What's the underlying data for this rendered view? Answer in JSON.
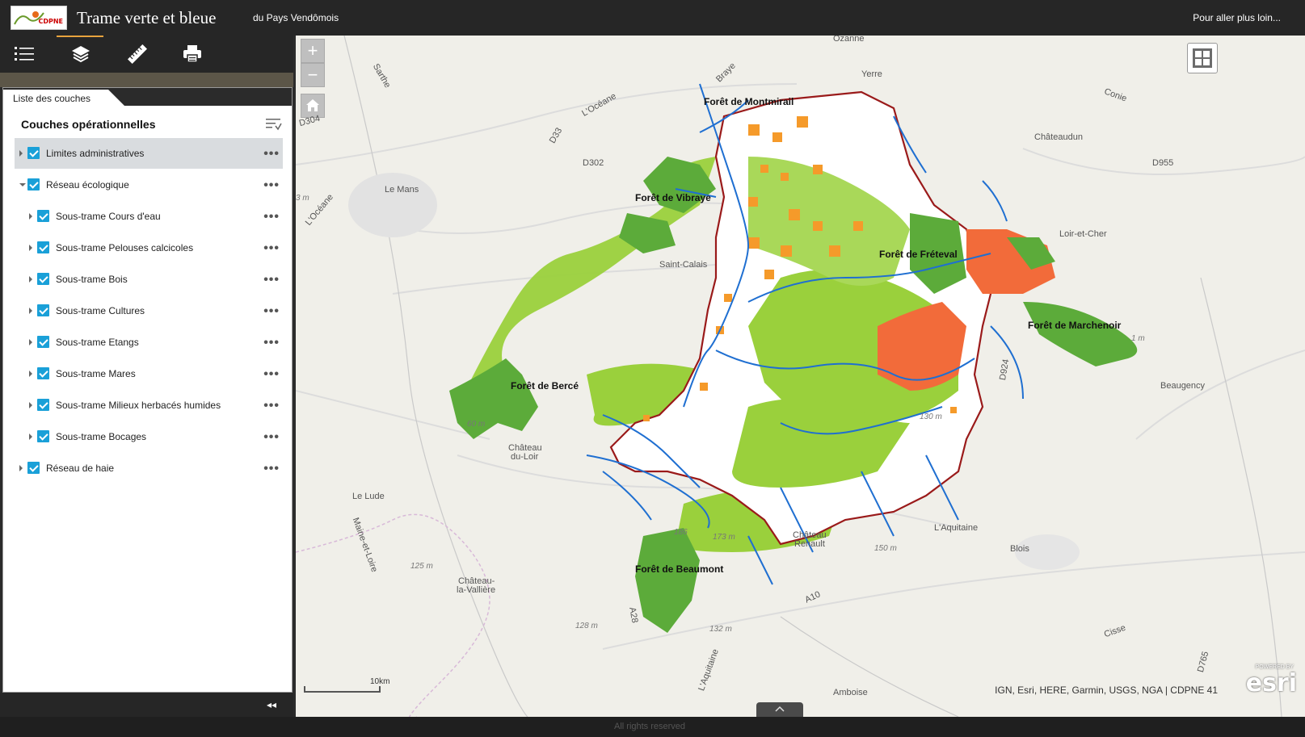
{
  "header": {
    "logo_text": "CDPNE",
    "title": "Trame verte et bleue",
    "subtitle": "du Pays Vendômois",
    "link": "Pour aller plus loin..."
  },
  "toolbar": {
    "tools": [
      "list-icon",
      "layers-icon",
      "ruler-icon",
      "print-icon"
    ],
    "active": "layers-icon",
    "accent": "#e8a33d"
  },
  "panel": {
    "tab": "Liste des couches",
    "heading": "Couches opérationnelles",
    "layers": [
      {
        "label": "Limites administratives",
        "checked": true,
        "expanded": false,
        "level": 0,
        "selected": true
      },
      {
        "label": "Réseau écologique",
        "checked": true,
        "expanded": true,
        "level": 0
      },
      {
        "label": "Sous-trame Cours d'eau",
        "checked": true,
        "expanded": false,
        "level": 1
      },
      {
        "label": "Sous-trame Pelouses calcicoles",
        "checked": true,
        "expanded": false,
        "level": 1
      },
      {
        "label": "Sous-trame Bois",
        "checked": true,
        "expanded": false,
        "level": 1
      },
      {
        "label": "Sous-trame Cultures",
        "checked": true,
        "expanded": false,
        "level": 1
      },
      {
        "label": "Sous-trame Etangs",
        "checked": true,
        "expanded": false,
        "level": 1
      },
      {
        "label": "Sous-trame Mares",
        "checked": true,
        "expanded": false,
        "level": 1
      },
      {
        "label": "Sous-trame Milieux herbacés humides",
        "checked": true,
        "expanded": false,
        "level": 1
      },
      {
        "label": "Sous-trame Bocages",
        "checked": true,
        "expanded": false,
        "level": 1
      },
      {
        "label": "Réseau de haie",
        "checked": true,
        "expanded": false,
        "level": 0
      }
    ],
    "collapse": "◂◂"
  },
  "map": {
    "zoom_in": "+",
    "zoom_out": "−",
    "places": {
      "ozanne": "Ozanne",
      "yerre": "Yerre",
      "chateaudun": "Châteaudun",
      "le_mans": "Le Mans",
      "saint_calais": "Saint-Calais",
      "loir_et_cher": "Loir-et-Cher",
      "beaugency": "Beaugency",
      "chateau_du_loir_1": "Château",
      "chateau_du_loir_2": "du-Loir",
      "le_lude": "Le Lude",
      "chateau_renault_1": "Château",
      "chateau_renault_2": "Renault",
      "blois": "Blois",
      "chateau_la_valliere_1": "Château-",
      "chateau_la_valliere_2": "la-Vallière",
      "amboise": "Amboise",
      "l_aquitaine_1": "L'Aquitaine",
      "l_aquitaine_2": "L'Aquitaine",
      "a10": "A10",
      "a28": "A28",
      "d302": "D302",
      "d304": "D304",
      "d33": "D33",
      "d955": "D955",
      "d924": "D924",
      "d765": "D765",
      "l_oceane": "L'Océane",
      "l_oceane_2": "L'Océane",
      "conie": "Conie",
      "cisse": "Cisse",
      "sarthe": "Sarthe",
      "braye": "Braye",
      "maine_et_loire": "Maine-et-Loire"
    },
    "forests": {
      "montmirail": "Forêt de Montmirail",
      "vibraye": "Forêt de Vibraye",
      "freteval": "Forêt de Fréteval",
      "marchenoir": "Forêt de Marchenoir",
      "berce": "Forêt de Bercé",
      "beaumont": "Forêt de Beaumont"
    },
    "altitudes": {
      "a1": "3 m",
      "a2": "60 m",
      "a3": "130 m",
      "a4": "186",
      "a5": "173 m",
      "a6": "150 m",
      "a7": "125 m",
      "a8": "128 m",
      "a9": "132 m",
      "a10": "1 m"
    },
    "scale": "10km",
    "attribution": "IGN, Esri, HERE, Garmin, USGS, NGA | CDPNE 41",
    "esri_powered": "POWERED BY",
    "esri": "esri",
    "colors": {
      "boundary": "#9a1a1a",
      "river": "#1f6fd1",
      "forest": "#5cab3a",
      "meadow": "#9ad03c",
      "orange": "#f59a2a",
      "red": "#f26b3a"
    }
  },
  "footer": {
    "rights": "All rights reserved"
  }
}
